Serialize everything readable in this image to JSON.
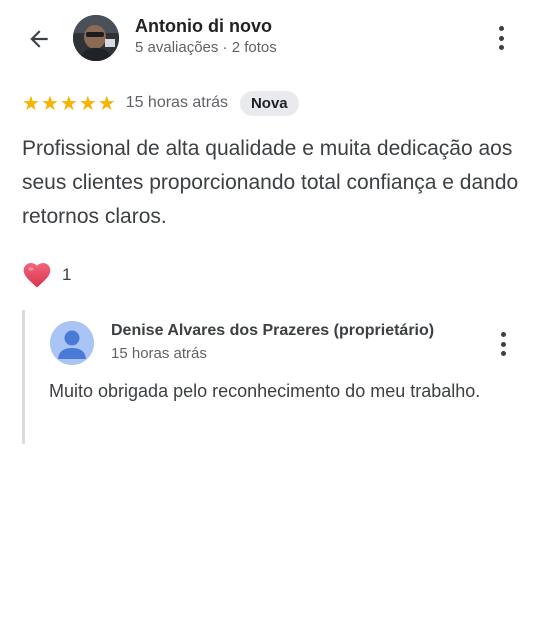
{
  "header": {
    "reviewer_name": "Antonio di novo",
    "reviewer_meta": "5 avaliações · 2 fotos"
  },
  "review": {
    "rating": 5,
    "time_ago": "15 horas atrás",
    "badge": "Nova",
    "text": "Profissional de alta qualidade e muita dedicação aos seus clientes proporcionando total confiança e dando retornos claros.",
    "likes": "1"
  },
  "reply": {
    "owner_name": "Denise Alvares dos Prazeres (proprietário)",
    "time_ago": "15 horas atrás",
    "text": "Muito obrigada pelo reconhecimento do meu trabalho."
  },
  "icons": {
    "back": "arrow-back-icon",
    "more": "more-vert-icon",
    "star": "star-icon",
    "heart": "heart-icon"
  },
  "colors": {
    "star": "#f6b400",
    "heart": "#e8445a",
    "badge_bg": "#e8eaed",
    "reply_border": "#dadce0"
  }
}
